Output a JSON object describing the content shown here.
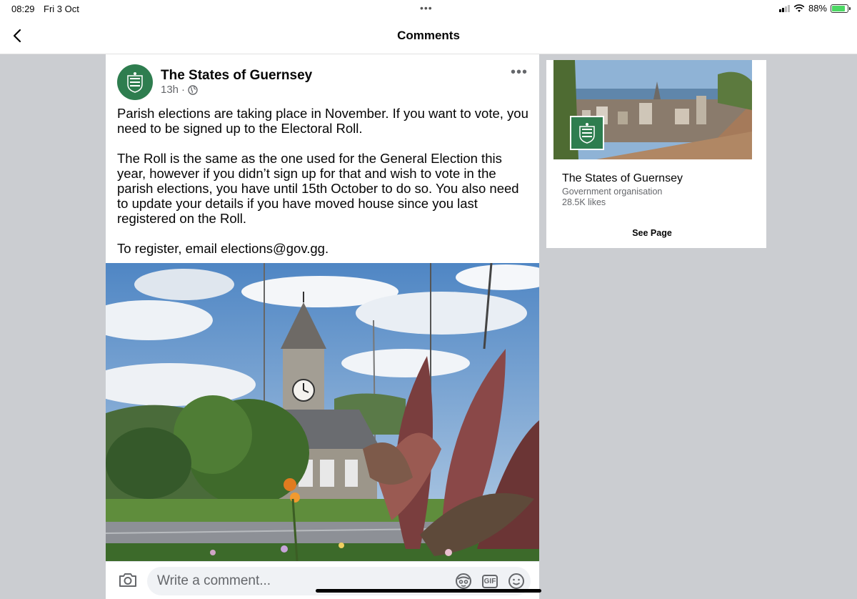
{
  "status": {
    "time": "08:29",
    "date": "Fri 3 Oct",
    "battery_pct": "88%",
    "battery_level": 0.88
  },
  "nav": {
    "title": "Comments",
    "back_icon": "chevron-left-icon"
  },
  "post": {
    "page_name": "The States of Guernsey",
    "time_ago": "13h",
    "separator": "·",
    "audience_icon": "globe-icon",
    "paragraphs": [
      "Parish elections are taking place in November. If you want to vote, you need to be signed up to the Electoral Roll.",
      "The Roll is the same as the one used for the General Election this year, however if you didn’t sign up for that and wish to vote in the parish elections, you have until 15th October to do so. You also need to update your details if you have moved house since you last registered on the Roll.",
      "To register, email elections@gov.gg."
    ]
  },
  "comment_bar": {
    "placeholder": "Write a comment...",
    "gif_label": "GIF"
  },
  "page_card": {
    "name": "The States of Guernsey",
    "category": "Government organisation",
    "likes": "28.5K likes",
    "see_page_label": "See Page"
  },
  "colors": {
    "brand_green": "#2e7d4f",
    "background": "#cbcdd1",
    "secondary_text": "#65676b"
  }
}
